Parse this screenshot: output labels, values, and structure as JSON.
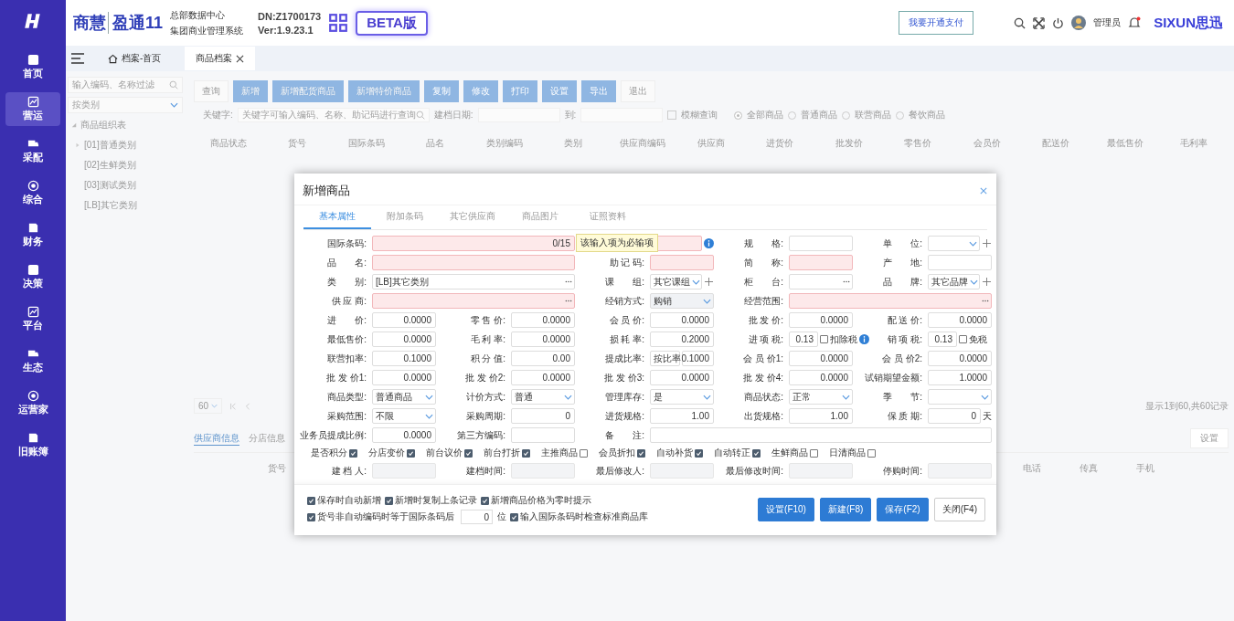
{
  "header": {
    "brand_main": "商慧",
    "brand_product": "盈通11",
    "subtitle_top": "总部数据中心",
    "subtitle_bottom": "集团商业管理系统",
    "dn": "DN:Z1700173",
    "version": "Ver:1.9.23.1",
    "beta_badge": "BETA版",
    "pay_button": "我要开通支付",
    "user": "管理员",
    "logo_text": "SIXUN思迅"
  },
  "sidebar": {
    "items": [
      {
        "label": "首页",
        "selected": false
      },
      {
        "label": "营运",
        "selected": true
      },
      {
        "label": "采配",
        "selected": false
      },
      {
        "label": "综合",
        "selected": false
      },
      {
        "label": "财务",
        "selected": false
      },
      {
        "label": "决策",
        "selected": false
      },
      {
        "label": "平台",
        "selected": false
      },
      {
        "label": "生态",
        "selected": false
      },
      {
        "label": "运营家",
        "selected": false
      },
      {
        "label": "旧账簿",
        "selected": false
      }
    ]
  },
  "tabs": [
    {
      "label": "档案-首页",
      "selected": false,
      "closable": false
    },
    {
      "label": "商品档案",
      "selected": true,
      "closable": true
    }
  ],
  "category_panel": {
    "search_placeholder": "输入编码、名称过滤",
    "filter_placeholder": "按类别",
    "tree": {
      "label": "商品组织表",
      "expanded": true,
      "children": [
        {
          "label": "[01]普通类别",
          "expandable": true
        },
        {
          "label": "[02]生鲜类别",
          "expandable": false
        },
        {
          "label": "[03]测试类别",
          "expandable": false
        },
        {
          "label": "[LB]其它类别",
          "expandable": false
        }
      ]
    }
  },
  "toolbar": [
    {
      "label": "查询",
      "kind": "plain"
    },
    {
      "label": "新增",
      "kind": "light"
    },
    {
      "label": "新增配货商品",
      "kind": "light"
    },
    {
      "label": "新增特价商品",
      "kind": "light"
    },
    {
      "label": "复制",
      "kind": "primary"
    },
    {
      "label": "修改",
      "kind": "primary"
    },
    {
      "label": "打印",
      "kind": "primary"
    },
    {
      "label": "设置",
      "kind": "primary"
    },
    {
      "label": "导出",
      "kind": "primary"
    },
    {
      "label": "退出",
      "kind": "plain"
    }
  ],
  "filters": {
    "keyword_label": "关键字:",
    "keyword_placeholder": "关键字可输入编码、名称、助记码进行查询",
    "date_label": "建档日期:",
    "to_label": "到:",
    "fuzzy": {
      "label": "模糊查询",
      "checked": false
    },
    "scopes": [
      {
        "label": "全部商品",
        "selected": true
      },
      {
        "label": "普通商品",
        "selected": false
      },
      {
        "label": "联营商品",
        "selected": false
      },
      {
        "label": "餐饮商品",
        "selected": false
      }
    ]
  },
  "table": {
    "columns": [
      "商品状态",
      "货号",
      "国际条码",
      "品名",
      "类别编码",
      "类别",
      "供应商编码",
      "供应商",
      "进货价",
      "批发价",
      "零售价",
      "会员价",
      "配送价",
      "最低售价",
      "毛利率"
    ]
  },
  "pager": {
    "page_size": "60",
    "summary": "显示1到60,共60记录"
  },
  "detail": {
    "tabs": [
      {
        "label": "供应商信息",
        "selected": true
      },
      {
        "label": "分店信息",
        "selected": false
      }
    ],
    "settings_button": "设置",
    "columns": [
      "货号",
      "电话",
      "传真",
      "手机"
    ]
  },
  "dialog": {
    "title": "新增商品",
    "tabs": [
      {
        "label": "基本属性",
        "selected": true
      },
      {
        "label": "附加条码",
        "selected": false
      },
      {
        "label": "其它供应商",
        "selected": false
      },
      {
        "label": "商品图片",
        "selected": false
      },
      {
        "label": "证照资料",
        "selected": false
      }
    ],
    "tooltip": "该输入项为必输项",
    "rows": [
      [
        {
          "label": "国际条码:",
          "kind": "text",
          "required": true,
          "counter": "0/15"
        },
        {
          "kind": "text",
          "required": true,
          "info": true
        },
        {
          "label": "规　　格:",
          "kind": "text",
          "required": false
        },
        {
          "label": "单　　位:",
          "kind": "select",
          "required": false,
          "plus": true
        }
      ],
      [
        {
          "label": "品　　名:",
          "kind": "text",
          "required": true
        },
        {
          "label": "助 记 码:",
          "kind": "text",
          "required": true
        },
        {
          "label": "简　　称:",
          "kind": "text",
          "required": true
        },
        {
          "label": "产　　地:",
          "kind": "text",
          "required": false
        }
      ],
      [
        {
          "label": "类　　别:",
          "kind": "picker",
          "value": "[LB]其它类别",
          "required": false
        },
        {
          "label": "课　　组:",
          "kind": "select",
          "value": "其它课组",
          "required": false,
          "plus": true
        },
        {
          "label": "柜　　台:",
          "kind": "picker",
          "required": false
        },
        {
          "label": "品　　牌:",
          "kind": "select",
          "value": "其它品牌",
          "required": false,
          "plus": true
        }
      ],
      [
        {
          "label": "供 应 商:",
          "kind": "picker",
          "required": true
        },
        {
          "label": "经销方式:",
          "kind": "select",
          "value": "购销",
          "required": false,
          "disabled": true
        },
        {
          "label": "经营范围:",
          "kind": "picker",
          "required": true
        }
      ],
      [
        {
          "label": "进　　价:",
          "kind": "number",
          "value": "0.0000",
          "required": false
        },
        {
          "label": "零 售 价:",
          "kind": "number",
          "value": "0.0000",
          "required": false
        },
        {
          "label": "会 员 价:",
          "kind": "number",
          "value": "0.0000",
          "required": false
        },
        {
          "label": "批 发 价:",
          "kind": "number",
          "value": "0.0000",
          "required": false
        },
        {
          "label": "配 送 价:",
          "kind": "number",
          "value": "0.0000",
          "required": false
        }
      ],
      [
        {
          "label": "最低售价:",
          "kind": "number",
          "value": "0.0000",
          "required": false
        },
        {
          "label": "毛 利 率:",
          "kind": "number",
          "value": "0.0000",
          "required": false
        },
        {
          "label": "损 耗 率:",
          "kind": "number",
          "value": "0.2000",
          "required": false
        },
        {
          "label": "进 项 税:",
          "kind": "number",
          "value": "0.13",
          "required": false,
          "check": {
            "label": "扣除税",
            "checked": false
          },
          "info": true
        },
        {
          "label": "销 项 税:",
          "kind": "number",
          "value": "0.13",
          "required": false,
          "check": {
            "label": "免税",
            "checked": false
          }
        }
      ],
      [
        {
          "label": "联营扣率:",
          "kind": "number",
          "value": "0.1000",
          "required": false
        },
        {
          "label": "积 分 值:",
          "kind": "number",
          "value": "0.00",
          "required": false
        },
        {
          "label": "提成比率:",
          "kind": "select_number",
          "value": "按比率",
          "value2": "0.1000",
          "required": false
        },
        {
          "label": "会 员 价1:",
          "kind": "number",
          "value": "0.0000",
          "required": false
        },
        {
          "label": "会 员 价2:",
          "kind": "number",
          "value": "0.0000",
          "required": false
        }
      ],
      [
        {
          "label": "批 发 价1:",
          "kind": "number",
          "value": "0.0000",
          "required": false
        },
        {
          "label": "批 发 价2:",
          "kind": "number",
          "value": "0.0000",
          "required": false
        },
        {
          "label": "批 发 价3:",
          "kind": "number",
          "value": "0.0000",
          "required": false
        },
        {
          "label": "批 发 价4:",
          "kind": "number",
          "value": "0.0000",
          "required": false
        },
        {
          "label": "试销期望金额:",
          "kind": "number",
          "value": "1.0000",
          "required": false
        }
      ],
      [
        {
          "label": "商品类型:",
          "kind": "select",
          "value": "普通商品",
          "required": false
        },
        {
          "label": "计价方式:",
          "kind": "select",
          "value": "普通",
          "required": false
        },
        {
          "label": "管理库存:",
          "kind": "select",
          "value": "是",
          "required": false
        },
        {
          "label": "商品状态:",
          "kind": "select",
          "value": "正常",
          "required": false
        },
        {
          "label": "季　　节:",
          "kind": "select",
          "required": false
        }
      ],
      [
        {
          "label": "采购范围:",
          "kind": "select",
          "value": "不限",
          "required": false
        },
        {
          "label": "采购周期:",
          "kind": "number",
          "value": "0",
          "required": false
        },
        {
          "label": "进货规格:",
          "kind": "number",
          "value": "1.00",
          "required": false
        },
        {
          "label": "出货规格:",
          "kind": "number",
          "value": "1.00",
          "required": false
        },
        {
          "label": "保 质 期:",
          "kind": "number",
          "value": "0",
          "suffix": "天",
          "required": false
        }
      ],
      [
        {
          "label": "业务员提成比例:",
          "kind": "number",
          "value": "0.0000",
          "required": false
        },
        {
          "label": "第三方编码:",
          "kind": "text",
          "required": false
        },
        {
          "label": "备　　注:",
          "kind": "text",
          "required": false
        }
      ]
    ],
    "flags": [
      {
        "label": "是否积分",
        "checked": true
      },
      {
        "label": "分店变价",
        "checked": true
      },
      {
        "label": "前台议价",
        "checked": true
      },
      {
        "label": "前台打折",
        "checked": true
      },
      {
        "label": "主推商品",
        "checked": false
      },
      {
        "label": "会员折扣",
        "checked": true
      },
      {
        "label": "自动补货",
        "checked": true
      },
      {
        "label": "自动转正",
        "checked": true
      },
      {
        "label": "生鲜商品",
        "checked": false
      },
      {
        "label": "日清商品",
        "checked": false
      }
    ],
    "audit": [
      {
        "label": "建 档 人:"
      },
      {
        "label": "建档时间:"
      },
      {
        "label": "最后修改人:"
      },
      {
        "label": "最后修改时间:"
      },
      {
        "label": "停购时间:"
      }
    ],
    "options": [
      {
        "label": "保存时自动新增",
        "checked": true
      },
      {
        "label": "新增时复制上条记录",
        "checked": true
      },
      {
        "label": "新增商品价格为零时提示",
        "checked": true
      }
    ],
    "barcode_option": {
      "checked": true,
      "label_before": "货号非自动编码时等于国际条码后",
      "value": "0",
      "label_after": "位"
    },
    "standard_option": {
      "label": "输入国际条码时检查标准商品库",
      "checked": true
    },
    "buttons": [
      {
        "label": "设置(F10)",
        "kind": "primary"
      },
      {
        "label": "新建(F8)",
        "kind": "primary"
      },
      {
        "label": "保存(F2)",
        "kind": "primary"
      },
      {
        "label": "关闭(F4)",
        "kind": "plain"
      }
    ]
  }
}
